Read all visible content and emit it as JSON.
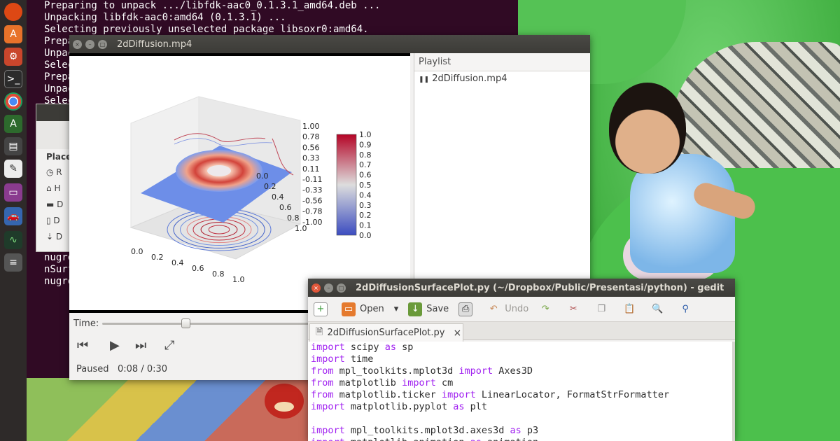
{
  "terminal": {
    "lines": [
      "Preparing to unpack .../libfdk-aac0_0.1.3.1_amd64.deb ...",
      "Unpacking libfdk-aac0:amd64 (0.1.3.1) ...",
      "Selecting previously unselected package libsoxr0:amd64.",
      "Prepa",
      "Unpac",
      "Selec",
      "Prepa",
      "Unpac",
      "Selec"
    ],
    "bottom_lines": [
      "nugre",
      "nSurf",
      "nugre"
    ]
  },
  "files": {
    "places_label": "Place",
    "items": [
      "R",
      "H",
      "D",
      "D",
      "D"
    ]
  },
  "player": {
    "title": "2dDiffusion.mp4",
    "playlist_header": "Playlist",
    "playlist_items": [
      "2dDiffusion.mp4"
    ],
    "time_label": "Time:",
    "status": "Paused",
    "time": "0:08 / 0:30",
    "progress": 0.27
  },
  "chart_data": {
    "type": "surface3d",
    "title": "",
    "x_ticks": [
      "0.0",
      "0.2",
      "0.4",
      "0.6",
      "0.8",
      "1.0"
    ],
    "y_ticks": [
      "0.0",
      "0.2",
      "0.4",
      "0.6",
      "0.8",
      "1.0"
    ],
    "z_ticks": [
      "1.00",
      "0.78",
      "0.56",
      "0.33",
      "0.11",
      "-0.11",
      "-0.33",
      "-0.56",
      "-0.78",
      "-1.00"
    ],
    "colorbar_ticks": [
      "1.0",
      "0.9",
      "0.8",
      "0.7",
      "0.6",
      "0.5",
      "0.4",
      "0.3",
      "0.2",
      "0.1",
      "0.0"
    ],
    "colormap": "coolwarm"
  },
  "gedit": {
    "title": "2dDiffusionSurfacePlot.py (~/Dropbox/Public/Presentasi/python) - gedit",
    "toolbar": {
      "open": "Open",
      "save": "Save",
      "undo": "Undo"
    },
    "tab": "2dDiffusionSurfacePlot.py",
    "code": [
      [
        [
          "kw",
          "import"
        ],
        [
          "t",
          " scipy "
        ],
        [
          "kw",
          "as"
        ],
        [
          "t",
          " sp"
        ]
      ],
      [
        [
          "kw",
          "import"
        ],
        [
          "t",
          " time"
        ]
      ],
      [
        [
          "kw",
          "from"
        ],
        [
          "t",
          " mpl_toolkits.mplot3d "
        ],
        [
          "kw",
          "import"
        ],
        [
          "t",
          " Axes3D"
        ]
      ],
      [
        [
          "kw",
          "from"
        ],
        [
          "t",
          " matplotlib "
        ],
        [
          "kw",
          "import"
        ],
        [
          "t",
          " cm"
        ]
      ],
      [
        [
          "kw",
          "from"
        ],
        [
          "t",
          " matplotlib.ticker "
        ],
        [
          "kw",
          "import"
        ],
        [
          "t",
          " LinearLocator, FormatStrFormatter"
        ]
      ],
      [
        [
          "kw",
          "import"
        ],
        [
          "t",
          " matplotlib.pyplot "
        ],
        [
          "kw",
          "as"
        ],
        [
          "t",
          " plt"
        ]
      ],
      [],
      [
        [
          "kw",
          "import"
        ],
        [
          "t",
          " mpl_toolkits.mplot3d.axes3d "
        ],
        [
          "kw",
          "as"
        ],
        [
          "t",
          " p3"
        ]
      ],
      [
        [
          "kw",
          "import"
        ],
        [
          "t",
          " matplotlib.animation "
        ],
        [
          "kw",
          "as"
        ],
        [
          "t",
          " animation"
        ]
      ]
    ]
  },
  "colors": {
    "terminal_bg": "#300a24",
    "keyword": "#a020f0",
    "titlebar": "#3c3b37",
    "close_btn": "#e2573a"
  }
}
